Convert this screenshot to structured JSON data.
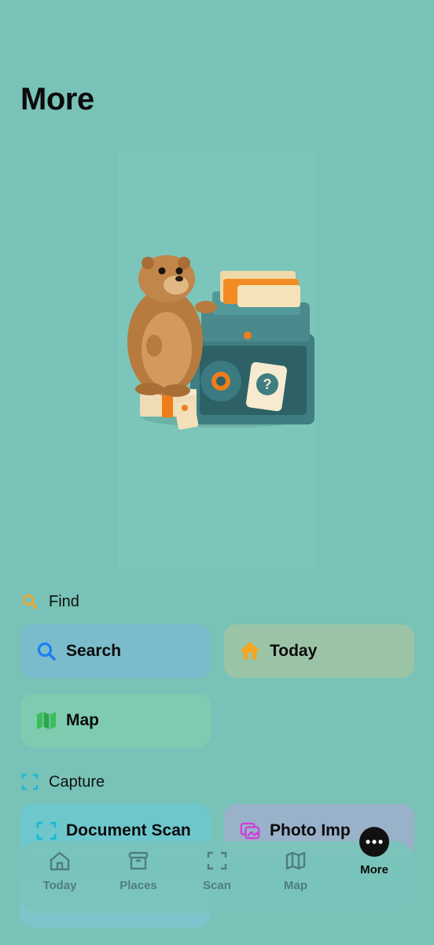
{
  "page": {
    "title": "More"
  },
  "sections": {
    "find": {
      "label": "Find",
      "tiles": {
        "search": "Search",
        "today": "Today",
        "map": "Map"
      }
    },
    "capture": {
      "label": "Capture",
      "tiles": {
        "document_scan": "Document Scan",
        "photo_import": "Photo Imp"
      }
    }
  },
  "tabbar": {
    "items": [
      "Today",
      "Places",
      "Scan",
      "Map",
      "More"
    ],
    "active": "More"
  },
  "colors": {
    "background": "#79c2b7",
    "search_tile": "#7bbccc",
    "today_tile": "#9bc4a6",
    "map_tile": "#7fcbb0",
    "docscan_tile": "#6ec7cc",
    "photo_tile": "#99b2c9",
    "accent_orange": "#f5a623",
    "accent_blue": "#1a7ff0",
    "accent_green": "#3bbd5a",
    "accent_cyan": "#1bb8d6",
    "accent_magenta": "#d23ad8"
  },
  "icons": {
    "find": "magnifier-icon",
    "search": "search-icon",
    "today": "house-icon",
    "map": "map-icon",
    "capture": "scan-frame-icon",
    "document_scan": "document-scan-icon",
    "photo_import": "photo-import-icon"
  }
}
